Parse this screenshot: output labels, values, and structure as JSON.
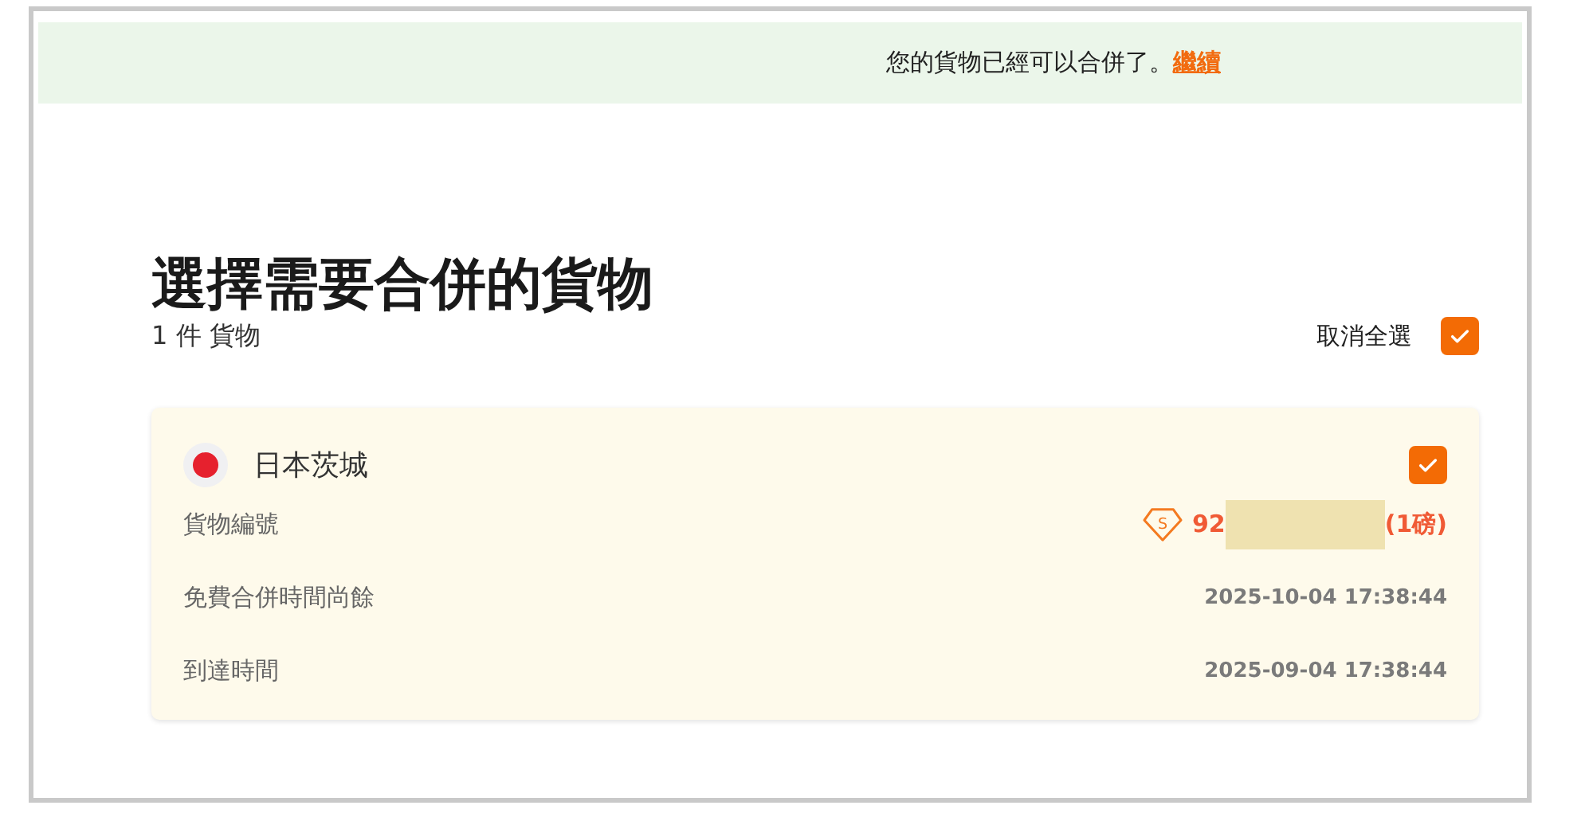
{
  "banner": {
    "message": "您的貨物已經可以合併了。",
    "link": "繼續"
  },
  "title": "選擇需要合併的貨物",
  "count": "1 件 貨物",
  "select_all": {
    "label": "取消全選",
    "checked": true
  },
  "shipments": [
    {
      "origin": "日本茨城",
      "checked": true,
      "fields": [
        {
          "kind": "tracking",
          "label": "貨物編號",
          "badge": "S",
          "value": "92",
          "suffix": "(1磅)"
        },
        {
          "kind": "time",
          "label": "免費合併時間尚餘",
          "value": "2025-10-04 17:38:44"
        },
        {
          "kind": "time",
          "label": "到達時間",
          "value": "2025-09-04 17:38:44"
        }
      ]
    }
  ]
}
